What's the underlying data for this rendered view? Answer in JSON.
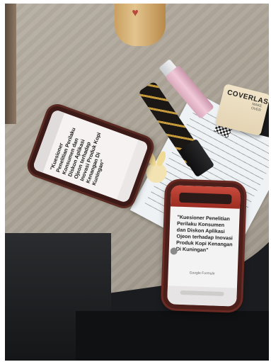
{
  "image": {
    "scene": "desk with two phones and cosmetics"
  },
  "phone_left": {
    "screen_text": "\"Kuesioner Penelitian Perilaku Konsumen dan Diskon Aplikasi Ojeon terhadap Inovasi Produk Kopi Kenangan Di Kuningan\""
  },
  "phone_right": {
    "screen_text": "\"Kuesioner Penelitian Perilaku Konsumen dan Diskon Aplikasi Ojeon terhadap Inovasi Produk Kopi Kenangan Di Kuningan\"",
    "footer_text": "Google Formulir"
  },
  "foundation": {
    "brand": "COVERLAST",
    "sub": "MAKE OVER"
  }
}
